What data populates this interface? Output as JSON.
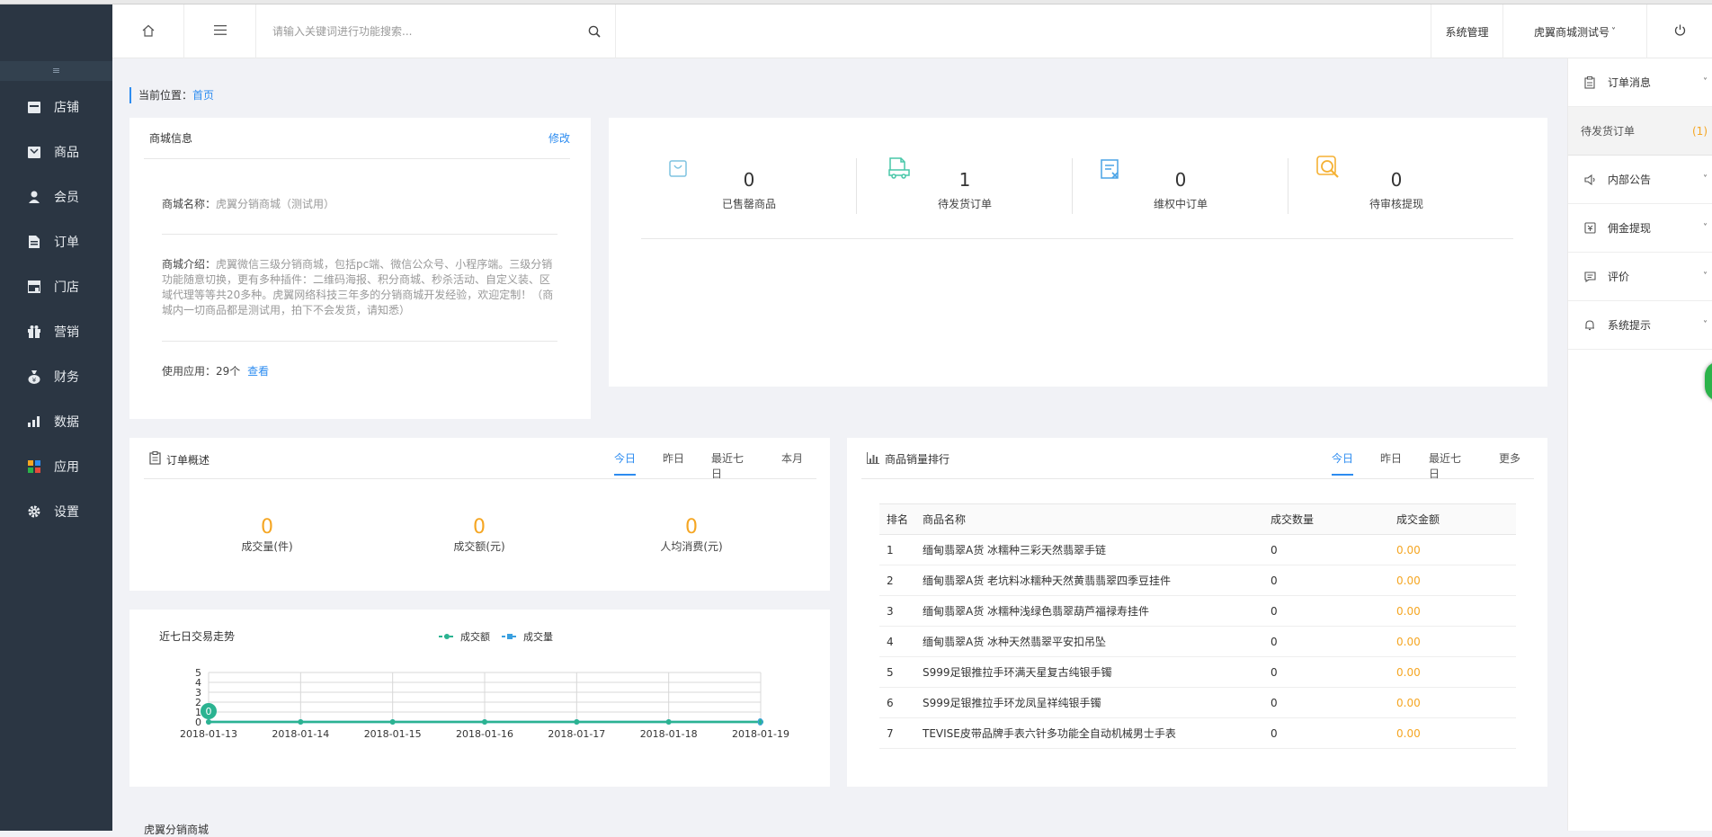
{
  "sidebar": {
    "collapse_label": "≡",
    "items": [
      {
        "label": "店铺",
        "icon": "store-icon"
      },
      {
        "label": "商品",
        "icon": "product-icon"
      },
      {
        "label": "会员",
        "icon": "member-icon"
      },
      {
        "label": "订单",
        "icon": "order-icon"
      },
      {
        "label": "门店",
        "icon": "shop-door-icon"
      },
      {
        "label": "营销",
        "icon": "gift-icon"
      },
      {
        "label": "财务",
        "icon": "money-bag-icon"
      },
      {
        "label": "数据",
        "icon": "bar-chart-icon"
      },
      {
        "label": "应用",
        "icon": "apps-icon"
      },
      {
        "label": "设置",
        "icon": "gear-icon"
      }
    ]
  },
  "topbar": {
    "search_placeholder": "请输入关键词进行功能搜索...",
    "system_manage": "系统管理",
    "account": "虎翼商城测试号",
    "account_chevron": "˅"
  },
  "breadcrumb": {
    "prefix": "当前位置：",
    "current": "首页"
  },
  "shop_info": {
    "title": "商城信息",
    "edit": "修改",
    "name_label": "商城名称：",
    "name_value": "虎翼分销商城（测试用）",
    "intro_label": "商城介绍：",
    "intro_value": "虎翼微信三级分销商城，包括pc端、微信公众号、小程序端。三级分销功能随意切换，更有多种插件：二维码海报、积分商城、秒杀活动、自定义装、区域代理等等共20多种。虎翼网络科技三年多的分销商城开发经验，欢迎定制！（商城内一切商品都是测试用，拍下不会发货，请知悉）",
    "apps_label": "使用应用：",
    "apps_value": "29个",
    "apps_link": "查看"
  },
  "stats": [
    {
      "value": "0",
      "label": "已售罄商品",
      "icon": "shopping-bag-icon"
    },
    {
      "value": "1",
      "label": "待发货订单",
      "icon": "delivery-truck-icon"
    },
    {
      "value": "0",
      "label": "维权中订单",
      "icon": "refund-doc-icon"
    },
    {
      "value": "0",
      "label": "待审核提现",
      "icon": "audit-search-icon"
    }
  ],
  "order_overview": {
    "title": "订单概述",
    "tabs": [
      "今日",
      "昨日",
      "最近七日",
      "本月"
    ],
    "metrics": [
      {
        "value": "0",
        "label": "成交量(件)"
      },
      {
        "value": "0",
        "label": "成交额(元)"
      },
      {
        "value": "0",
        "label": "人均消费(元)"
      }
    ]
  },
  "ranking": {
    "title": "商品销量排行",
    "tabs": [
      "今日",
      "昨日",
      "最近七日",
      "更多"
    ],
    "headers": [
      "排名",
      "商品名称",
      "成交数量",
      "成交金额"
    ],
    "rows": [
      {
        "rank": "1",
        "name": "缅甸翡翠A货 冰糯种三彩天然翡翠手链",
        "qty": "0",
        "amount": "0.00"
      },
      {
        "rank": "2",
        "name": "缅甸翡翠A货 老坑料冰糯种天然黄翡翡翠四季豆挂件",
        "qty": "0",
        "amount": "0.00"
      },
      {
        "rank": "3",
        "name": "缅甸翡翠A货 冰糯种浅绿色翡翠葫芦福禄寿挂件",
        "qty": "0",
        "amount": "0.00"
      },
      {
        "rank": "4",
        "name": "缅甸翡翠A货 冰种天然翡翠平安扣吊坠",
        "qty": "0",
        "amount": "0.00"
      },
      {
        "rank": "5",
        "name": "S999足银推拉手环满天星复古纯银手镯",
        "qty": "0",
        "amount": "0.00"
      },
      {
        "rank": "6",
        "name": "S999足银推拉手环龙凤呈祥纯银手镯",
        "qty": "0",
        "amount": "0.00"
      },
      {
        "rank": "7",
        "name": "TEVISE皮带品牌手表六针多功能全自动机械男士手表",
        "qty": "0",
        "amount": "0.00"
      }
    ]
  },
  "chart_data": {
    "type": "line",
    "title": "近七日交易走势",
    "x": [
      "2018-01-13",
      "2018-01-14",
      "2018-01-15",
      "2018-01-16",
      "2018-01-17",
      "2018-01-18",
      "2018-01-19"
    ],
    "series": [
      {
        "name": "成交额",
        "values": [
          0,
          0,
          0,
          0,
          0,
          0,
          0
        ],
        "color": "#2bb391"
      },
      {
        "name": "成交量",
        "values": [
          0,
          0,
          0,
          0,
          0,
          0,
          0
        ],
        "color": "#3aa0e0"
      }
    ],
    "yticks": [
      "0",
      "1",
      "2",
      "3",
      "4",
      "5"
    ],
    "ylim": [
      0,
      5
    ],
    "grid": true,
    "legend": "top-center",
    "point_label": "0",
    "end_label": "0"
  },
  "right_panel": {
    "items": [
      {
        "label": "订单消息",
        "icon": "clipboard-icon",
        "chevron": "˅"
      },
      {
        "label": "内部公告",
        "icon": "speaker-icon",
        "chevron": "˅"
      },
      {
        "label": "佣金提现",
        "icon": "wallet-icon",
        "chevron": "˅"
      },
      {
        "label": "评价",
        "icon": "comment-icon",
        "chevron": "˅"
      },
      {
        "label": "系统提示",
        "icon": "bell-icon",
        "chevron": "˅"
      }
    ],
    "pending": {
      "label": "待发货订单",
      "count": "(1)"
    }
  },
  "footer_partial": "虎翼分销商城",
  "colors": {
    "accent": "#2d8cf0",
    "orange": "#f5a623",
    "sidebar": "#2b3643"
  }
}
